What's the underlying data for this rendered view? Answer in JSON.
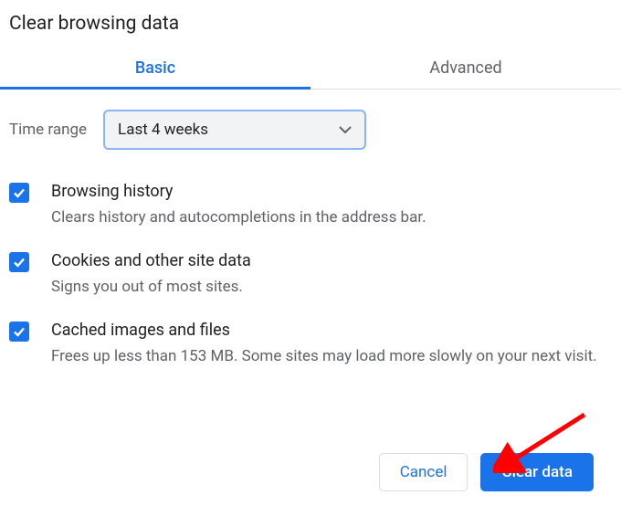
{
  "title": "Clear browsing data",
  "tabs": {
    "basic": "Basic",
    "advanced": "Advanced"
  },
  "timerange": {
    "label": "Time range",
    "value": "Last 4 weeks"
  },
  "options": [
    {
      "title": "Browsing history",
      "desc": "Clears history and autocompletions in the address bar.",
      "checked": true
    },
    {
      "title": "Cookies and other site data",
      "desc": "Signs you out of most sites.",
      "checked": true
    },
    {
      "title": "Cached images and files",
      "desc": "Frees up less than 153 MB. Some sites may load more slowly on your next visit.",
      "checked": true
    }
  ],
  "buttons": {
    "cancel": "Cancel",
    "clear": "Clear data"
  },
  "annotation": {
    "arrow_color": "#ff0000"
  }
}
